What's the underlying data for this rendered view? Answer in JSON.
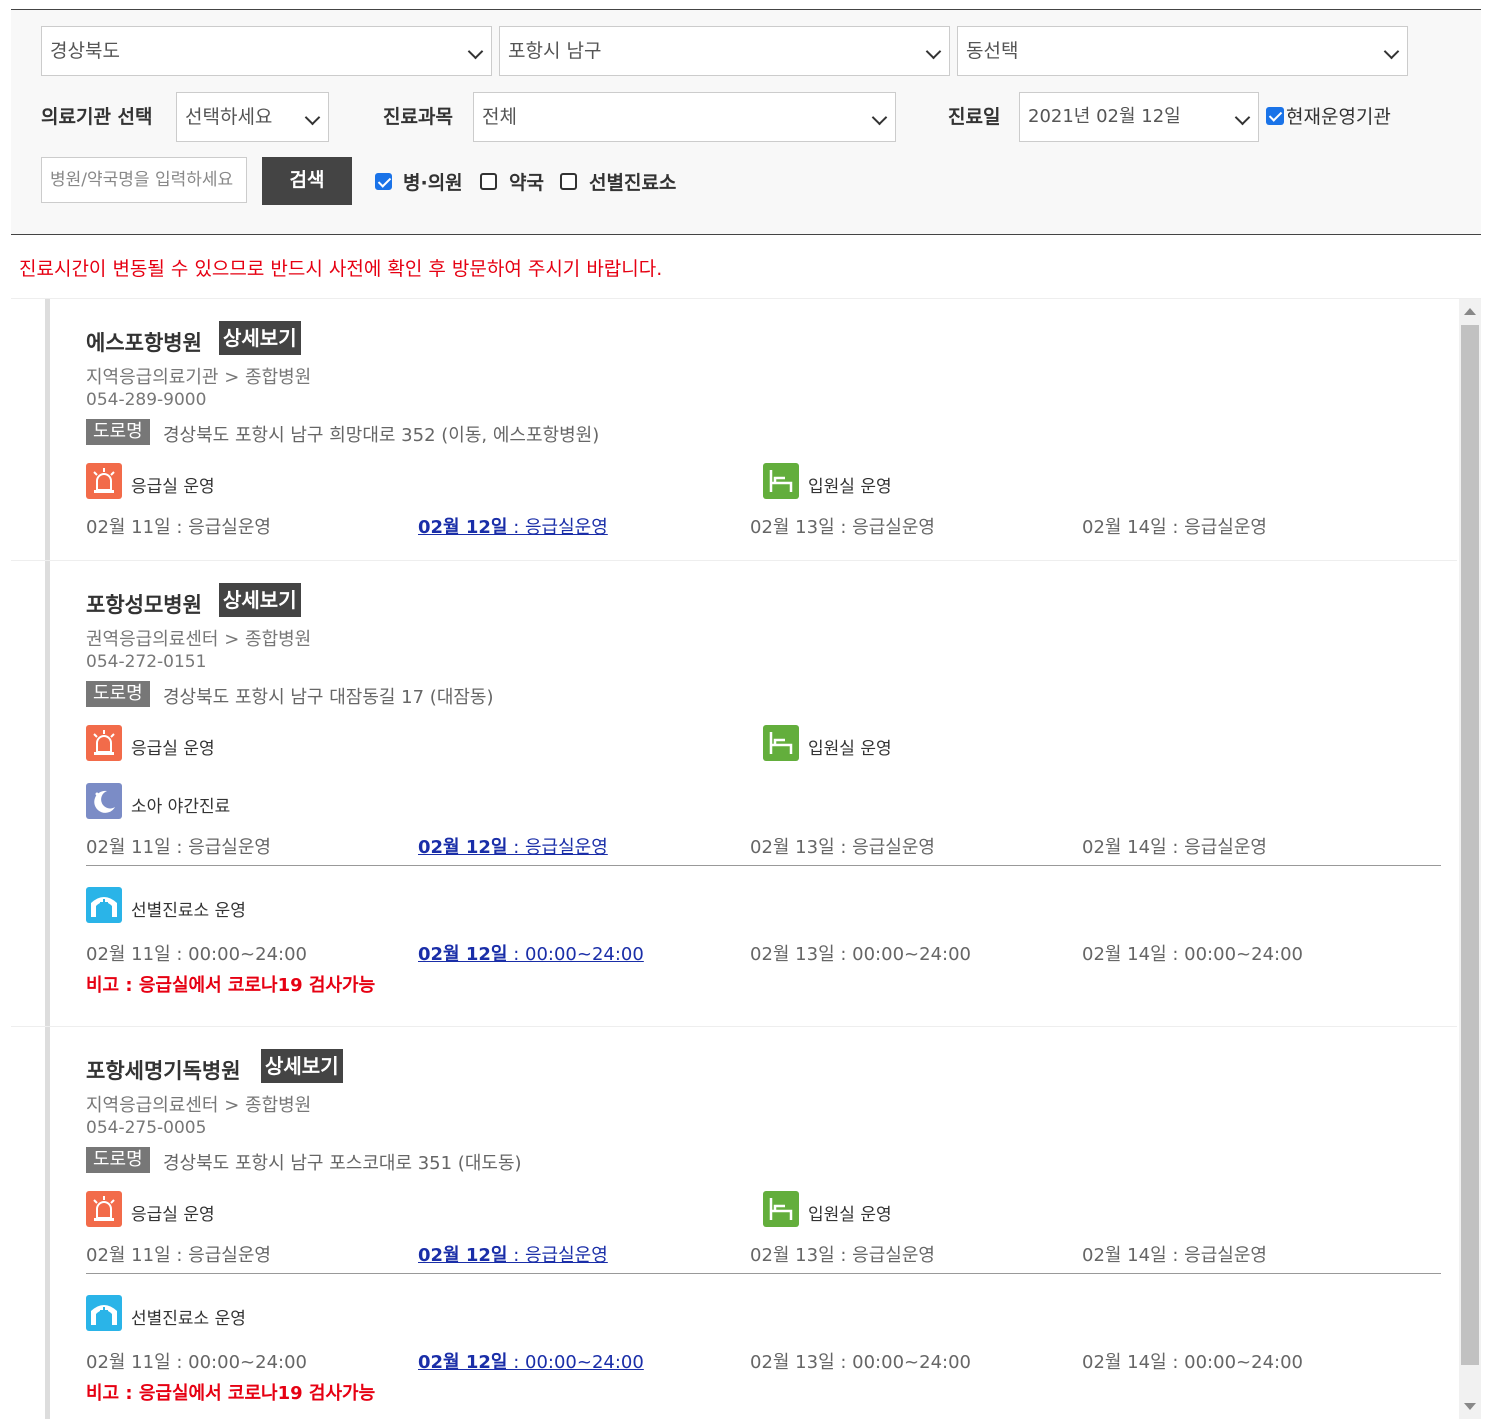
{
  "filters": {
    "province": "경상북도",
    "city": "포항시 남구",
    "dong": "동선택",
    "facility_label": "의료기관 선택",
    "facility_value": "선택하세요",
    "dept_label": "진료과목",
    "dept_value": "전체",
    "date_label": "진료일",
    "date_value": "2021년 02월 12일",
    "current_label": "현재운영기관",
    "search_placeholder": "병원/약국명을 입력하세요",
    "search_button": "검색",
    "type_hospital": "병·의원",
    "type_pharmacy": "약국",
    "type_clinic": "선별진료소"
  },
  "notice": "진료시간이 변동될 수 있으므로 반드시 사전에 확인 후 방문하여 주시기 바랍니다.",
  "detail_label": "상세보기",
  "road_label": "도로명",
  "hospitals": [
    {
      "name": "에스포항병원",
      "category": "지역응급의료기관 > 종합병원",
      "phone": "054-289-9000",
      "address": "경상북도 포항시 남구 희망대로 352 (이동, 에스포항병원)",
      "svc_er": "응급실 운영",
      "svc_bed": "입원실 운영",
      "days": [
        "02월 11일 : 응급실운영",
        "02월 12일",
        " : 응급실운영",
        "02월 13일 : 응급실운영",
        "02월 14일 : 응급실운영"
      ]
    },
    {
      "name": "포항성모병원",
      "category": "권역응급의료센터 > 종합병원",
      "phone": "054-272-0151",
      "address": "경상북도 포항시 남구 대잠동길 17 (대잠동)",
      "svc_er": "응급실 운영",
      "svc_bed": "입원실 운영",
      "svc_night": "소아 야간진료",
      "days": [
        "02월 11일 : 응급실운영",
        "02월 12일",
        " : 응급실운영",
        "02월 13일 : 응급실운영",
        "02월 14일 : 응급실운영"
      ],
      "svc_clinic": "선별진료소 운영",
      "clinic_days": [
        "02월 11일 : 00:00~24:00",
        "02월 12일",
        " : 00:00~24:00",
        "02월 13일 : 00:00~24:00",
        "02월 14일 : 00:00~24:00"
      ],
      "remark": "비고 : 응급실에서 코로나19 검사가능"
    },
    {
      "name": "포항세명기독병원",
      "category": "지역응급의료센터 > 종합병원",
      "phone": "054-275-0005",
      "address": "경상북도 포항시 남구 포스코대로 351 (대도동)",
      "svc_er": "응급실 운영",
      "svc_bed": "입원실 운영",
      "days": [
        "02월 11일 : 응급실운영",
        "02월 12일",
        " : 응급실운영",
        "02월 13일 : 응급실운영",
        "02월 14일 : 응급실운영"
      ],
      "svc_clinic": "선별진료소 운영",
      "clinic_days": [
        "02월 11일 : 00:00~24:00",
        "02월 12일",
        " : 00:00~24:00",
        "02월 13일 : 00:00~24:00",
        "02월 14일 : 00:00~24:00"
      ],
      "remark": "비고 : 응급실에서 코로나19 검사가능"
    }
  ],
  "icons": {
    "er": "ambulance-siren-icon",
    "bed": "hospital-bed-icon",
    "night": "moon-icon",
    "clinic": "screening-tent-icon"
  },
  "colors": {
    "notice": "#e60012",
    "today_link": "#1a2ea8",
    "er_icon": "#f26b4a",
    "bed_icon": "#63ae3c",
    "night_icon": "#7b8cc6",
    "clinic_icon": "#2ab4e8"
  }
}
